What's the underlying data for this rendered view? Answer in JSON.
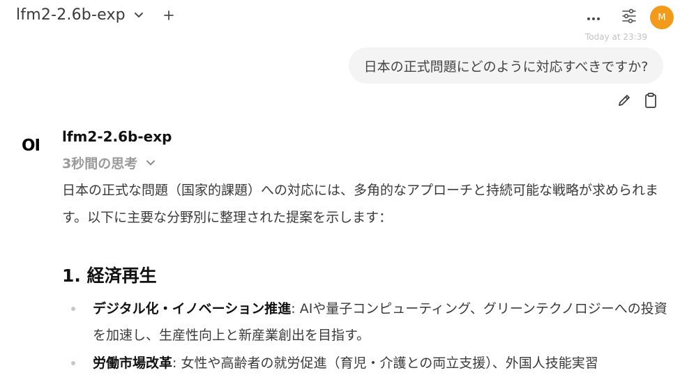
{
  "header": {
    "model_name": "lfm2-2.6b-exp",
    "avatar_initial": "M",
    "avatar_color": "#f29a1a",
    "timestamp": "Today at 23:39"
  },
  "user_message": {
    "text": "日本の正式問題にどのように対応すべきですか?"
  },
  "assistant": {
    "logo_text": "OI",
    "name": "lfm2-2.6b-exp",
    "thinking_label": "3秒間の思考",
    "intro": "日本の正式な問題（国家的課題）への対応には、多角的なアプローチと持続可能な戦略が求められます。以下に主要な分野別に整理された提案を示します：",
    "section_heading": "1. 経済再生",
    "bullets": [
      {
        "term": "デジタル化・イノベーション推進",
        "text": ": AIや量子コンピューティング、グリーンテクノロジーへの投資を加速し、生産性向上と新産業創出を目指す。"
      },
      {
        "term": "労働市場改革",
        "text": ": 女性や高齢者の就労促進（育児・介護との両立支援）、外国人技能実習"
      }
    ]
  },
  "icons": {
    "model_chevron": "chevron-down-icon",
    "new_chat": "plus-icon",
    "more": "ellipsis-icon",
    "controls": "sliders-icon",
    "edit": "pencil-icon",
    "copy": "clipboard-icon",
    "thinking_chevron": "chevron-down-icon"
  }
}
